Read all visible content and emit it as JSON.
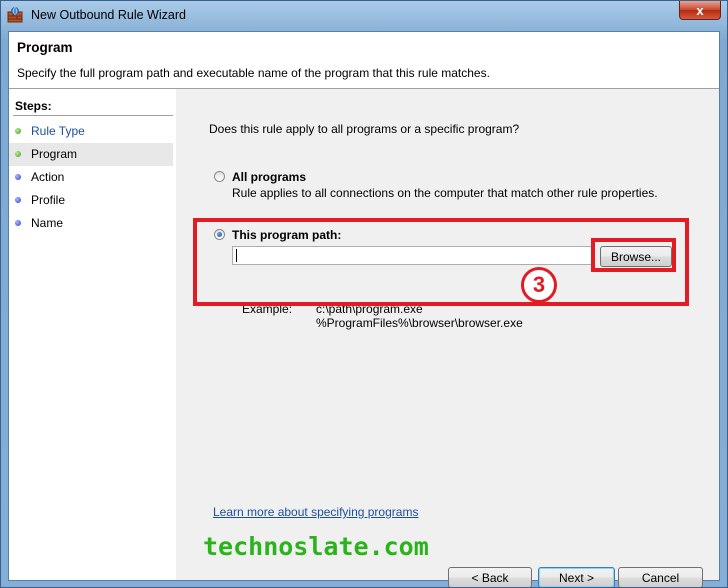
{
  "window": {
    "title": "New Outbound Rule Wizard",
    "close_label": "x"
  },
  "header": {
    "title": "Program",
    "description": "Specify the full program path and executable name of the program that this rule matches."
  },
  "steps": {
    "label": "Steps:",
    "items": [
      {
        "label": "Rule Type",
        "status": "done"
      },
      {
        "label": "Program",
        "status": "current"
      },
      {
        "label": "Action",
        "status": "pending"
      },
      {
        "label": "Profile",
        "status": "pending"
      },
      {
        "label": "Name",
        "status": "pending"
      }
    ]
  },
  "main": {
    "question": "Does this rule apply to all programs or a specific program?",
    "all_programs": {
      "label": "All programs",
      "description": "Rule applies to all connections on the computer that match other rule properties.",
      "selected": false
    },
    "program_path": {
      "label": "This program path:",
      "value": "",
      "selected": true,
      "browse_label": "Browse...",
      "example_label": "Example:",
      "example_lines": [
        "c:\\path\\program.exe",
        "%ProgramFiles%\\browser\\browser.exe"
      ]
    },
    "annotation_number": "3",
    "learn_more": "Learn more about specifying programs",
    "watermark": "technoslate.com"
  },
  "buttons": {
    "back": "< Back",
    "next": "Next >",
    "cancel": "Cancel"
  },
  "colors": {
    "highlight": "#e21c24",
    "watermark": "#2ab31b",
    "link": "#1b4f9c"
  }
}
